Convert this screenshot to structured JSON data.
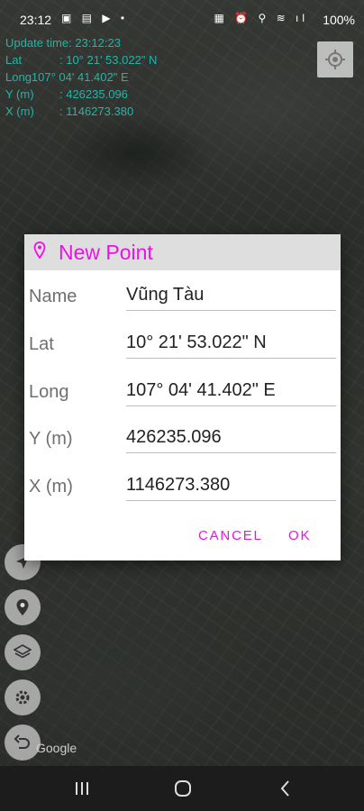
{
  "status_bar": {
    "time": "23:12",
    "left_icons": "▣ ▤ ▶ •",
    "right_icons": "▦ ⏰ ⚲ ≋ ıl",
    "battery": "100%"
  },
  "info_overlay": {
    "update_label": "Update time:",
    "update_value": "23:12:23",
    "lat_label": "Lat",
    "lat_value": ": 10° 21' 53.022\" N",
    "long_label": "Long",
    "long_value": "107° 04' 41.402\" E",
    "y_label": "Y (m)",
    "y_value": ": 426235.096",
    "x_label": "X (m)",
    "x_value": ": 1146273.380"
  },
  "map": {
    "attribution": "Google"
  },
  "dialog": {
    "title": "New Point",
    "fields": [
      {
        "label": "Name",
        "value": "Vũng Tàu"
      },
      {
        "label": "Lat",
        "value": "10° 21' 53.022\" N"
      },
      {
        "label": "Long",
        "value": "107° 04' 41.402\" E"
      },
      {
        "label": "Y (m)",
        "value": "426235.096"
      },
      {
        "label": "X (m)",
        "value": "1146273.380"
      }
    ],
    "cancel_label": "CANCEL",
    "ok_label": "OK"
  },
  "colors": {
    "accent": "#ee10e8",
    "info_text": "#1fb6a6"
  }
}
